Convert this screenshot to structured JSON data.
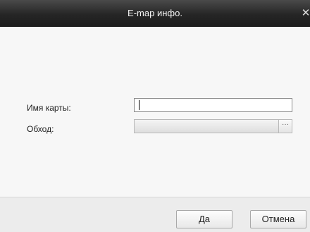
{
  "window": {
    "title": "E-map инфо.",
    "close_glyph": "✕"
  },
  "form": {
    "map_name": {
      "label": "Имя карты:",
      "value": ""
    },
    "route": {
      "label": "Обход:",
      "value": "",
      "browse_glyph": "···"
    }
  },
  "buttons": {
    "ok_label": "Да",
    "cancel_label": "Отмена"
  },
  "colors": {
    "titlebar": "#262626",
    "title_text": "#f2f2f2",
    "content_bg": "#f7f7f7",
    "footer_bg": "#ececec"
  }
}
